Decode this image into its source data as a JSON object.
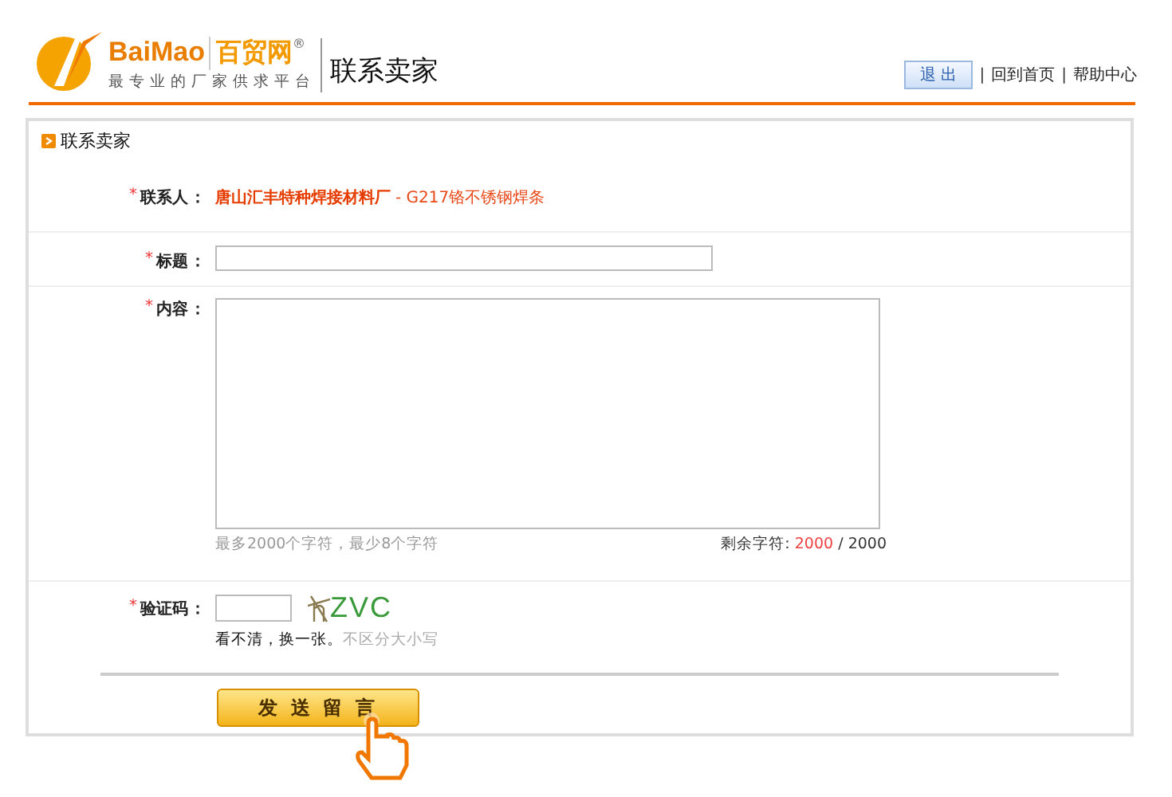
{
  "header": {
    "logo_latin": "BaiMao",
    "logo_cn": "百贸网",
    "registered": "®",
    "slogan": "最专业的厂家供求平台",
    "page_title": "联系卖家",
    "logout": "退 出",
    "links": [
      {
        "label": "回到首页"
      },
      {
        "label": "帮助中心"
      }
    ],
    "separators": [
      "|",
      "|"
    ]
  },
  "panel": {
    "title": "联系卖家"
  },
  "form": {
    "contact": {
      "label": "联系人",
      "required": "*",
      "colon": "：",
      "company": "唐山汇丰特种焊接材料厂",
      "dash": "-",
      "product": "G217铬不锈钢焊条"
    },
    "subject": {
      "label": "标题",
      "required": "*",
      "colon": "："
    },
    "content": {
      "label": "内容",
      "required": "*",
      "colon": "：",
      "hint": "最多2000个字符，最少8个字符",
      "remaining_label": "剩余字符:",
      "remaining": "2000",
      "slash": "/",
      "max": "2000"
    },
    "captcha": {
      "label": "验证码",
      "required": "*",
      "colon": "：",
      "code": "ZVC",
      "refresh": "看不清，换一张。",
      "note": "不区分大小写"
    },
    "submit": "发 送 留 言"
  }
}
